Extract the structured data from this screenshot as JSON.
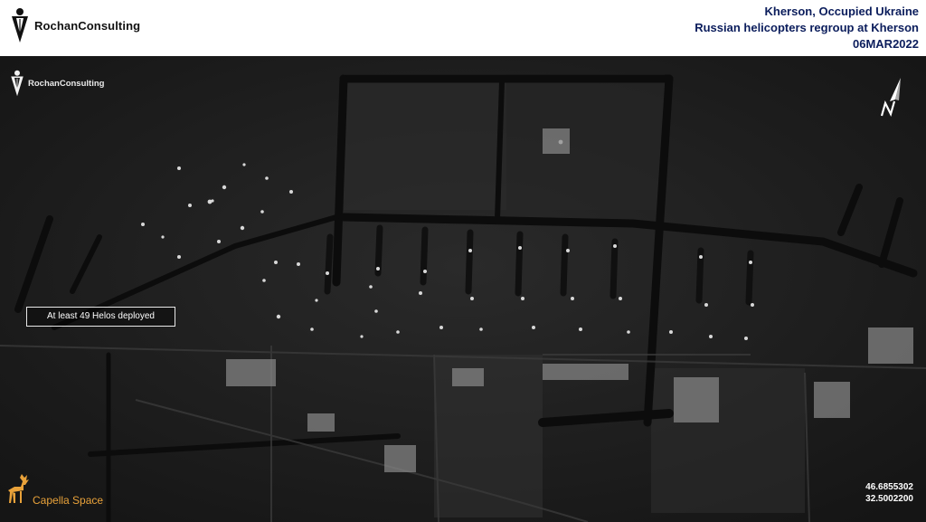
{
  "header": {
    "brand_name": "RochanConsulting",
    "location": "Kherson, Occupied Ukraine",
    "headline": "Russian helicopters regroup at Kherson",
    "date": "06MAR2022"
  },
  "image": {
    "watermark_brand": "RochanConsulting",
    "annotation": "At least 49 Helos deployed",
    "provider": "Capella Space",
    "latitude": "46.6855302",
    "longitude": "32.5002200",
    "north_arrow_icon": "north-arrow-icon"
  },
  "colors": {
    "title_text": "#0b1d5c",
    "capella_accent": "#e9a23a",
    "imagery_background": "#1c1c1c"
  }
}
